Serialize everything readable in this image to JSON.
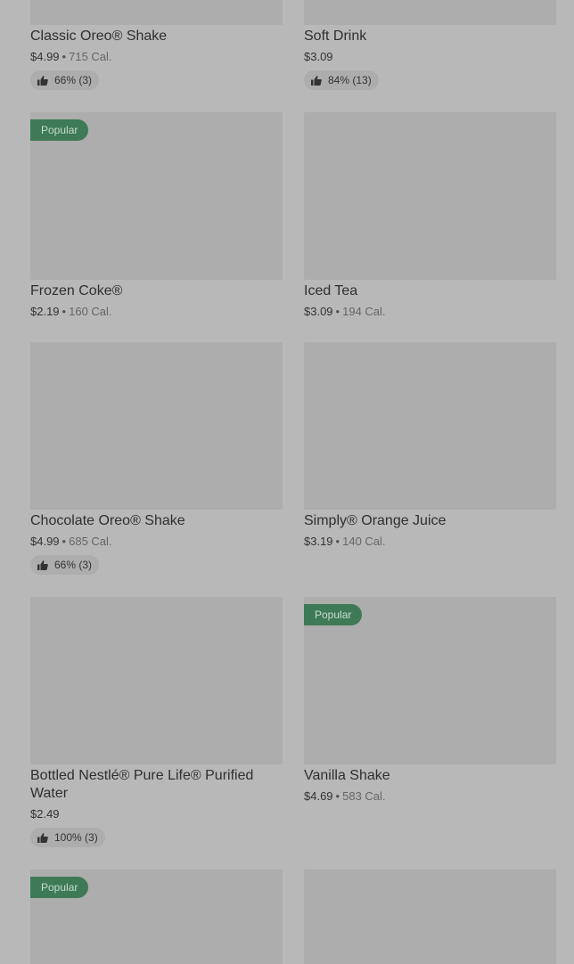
{
  "items": [
    {
      "name": "Classic Oreo® Shake",
      "price": "$4.99",
      "calories": "715 Cal.",
      "rating": "66% (3)",
      "popular": ""
    },
    {
      "name": "Soft Drink",
      "price": "$3.09",
      "calories": "",
      "rating": "84% (13)",
      "popular": ""
    },
    {
      "name": "Frozen Coke®",
      "price": "$2.19",
      "calories": "160 Cal.",
      "rating": "",
      "popular": "Popular"
    },
    {
      "name": "Iced Tea",
      "price": "$3.09",
      "calories": "194 Cal.",
      "rating": "",
      "popular": ""
    },
    {
      "name": "Chocolate Oreo® Shake",
      "price": "$4.99",
      "calories": "685 Cal.",
      "rating": "66% (3)",
      "popular": ""
    },
    {
      "name": "Simply® Orange Juice",
      "price": "$3.19",
      "calories": "140 Cal.",
      "rating": "",
      "popular": ""
    },
    {
      "name": "Bottled Nestlé® Pure Life® Purified Water",
      "price": "$2.49",
      "calories": "",
      "rating": "100% (3)",
      "popular": ""
    },
    {
      "name": "Vanilla Shake",
      "price": "$4.69",
      "calories": "583 Cal.",
      "rating": "",
      "popular": "Popular"
    },
    {
      "name": "",
      "price": "",
      "calories": "",
      "rating": "",
      "popular": "Popular"
    },
    {
      "name": "",
      "price": "",
      "calories": "",
      "rating": "",
      "popular": ""
    }
  ],
  "separator": "•",
  "colors": {
    "popular_badge": "#3e7a56",
    "background": "#b8b8b8",
    "image_placeholder": "#adadad"
  },
  "icons": {
    "rating": "thumbs-up-icon"
  }
}
